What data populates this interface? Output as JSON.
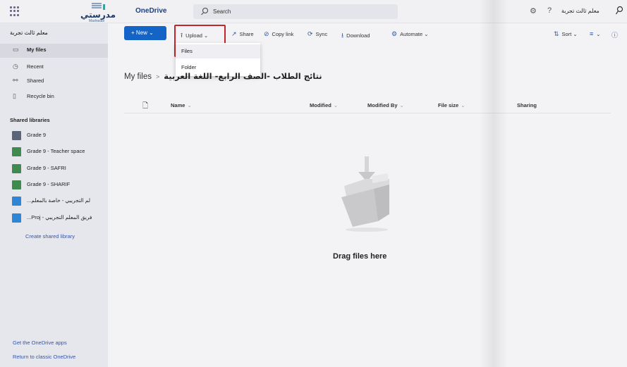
{
  "header": {
    "logo_text": "مدرستي",
    "logo_sub": "Madrasati",
    "app_name": "OneDrive",
    "search_placeholder": "Search",
    "user_name": "معلم ثالث تجربة",
    "icons": [
      "waffle-icon",
      "settings-icon",
      "help-icon",
      "person-icon"
    ]
  },
  "sidebar": {
    "owner": "معلم ثالث تجربة",
    "items": [
      {
        "label": "My files",
        "icon": "folder-icon",
        "active": true
      },
      {
        "label": "Recent",
        "icon": "clock-icon"
      },
      {
        "label": "Shared",
        "icon": "share-icon"
      },
      {
        "label": "Recycle bin",
        "icon": "trash-icon"
      }
    ],
    "shared_header": "Shared libraries",
    "libraries": [
      {
        "label": "Grade 9",
        "color": "#5c6478"
      },
      {
        "label": "Grade 9 - Teacher space",
        "color": "#3f8a4f"
      },
      {
        "label": "Grade 9 - SAFRI",
        "color": "#3f8a4f"
      },
      {
        "label": "Grade 9 - SHARIF",
        "color": "#3f8a4f"
      },
      {
        "label": "...لم التجريبي - خاصة بالمعلم",
        "color": "#2f86d6"
      },
      {
        "label": "...Proj - فريق المعلم التجريبي",
        "color": "#2f86d6"
      }
    ],
    "create_link": "Create shared library",
    "apps_link": "Get the OneDrive apps",
    "classic_link": "Return to classic OneDrive"
  },
  "commands": {
    "new": "New",
    "upload": "Upload",
    "share": "Share",
    "copy_link": "Copy link",
    "sync": "Sync",
    "download": "Download",
    "automate": "Automate",
    "sort": "Sort"
  },
  "upload_menu": [
    "Files",
    "Folder"
  ],
  "breadcrumb": {
    "root": "My files",
    "current": "نتائج الطلاب -الصف الرابع- اللغة العربية"
  },
  "columns": {
    "name": "Name",
    "modified": "Modified",
    "modified_by": "Modified By",
    "file_size": "File size",
    "sharing": "Sharing"
  },
  "empty": {
    "text": "Drag files here"
  },
  "colors": {
    "accent": "#1463c6",
    "highlight": "#c0262c"
  }
}
